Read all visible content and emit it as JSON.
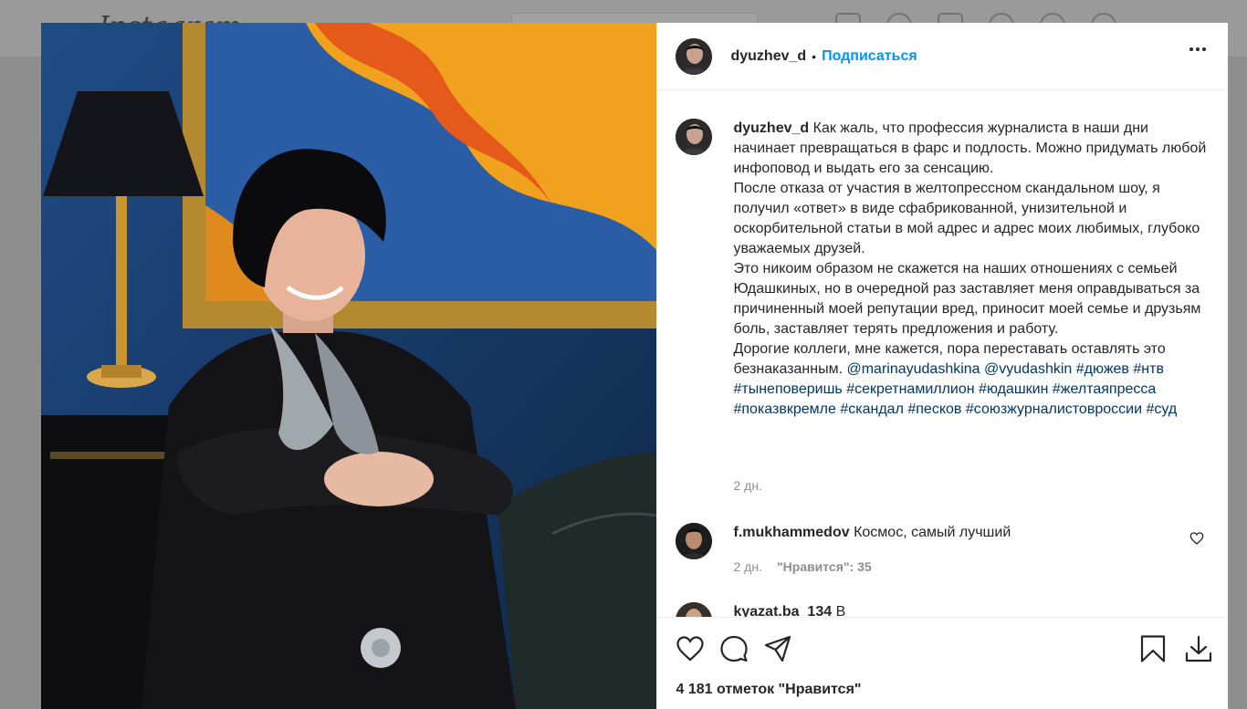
{
  "background": {
    "logo": "Instagram"
  },
  "post": {
    "username": "dyuzhev_d",
    "separator": "•",
    "follow_label": "Подписаться",
    "more_icon": "more-horizontal-icon"
  },
  "caption": {
    "username": "dyuzhev_d",
    "p1": "Как жаль, что профессия журналиста в наши дни начинает превращаться в фарс и подлость. Можно придумать любой инфоповод и выдать его за сенсацию.",
    "p2": "После отказа от участия в желтопрессном скандальном шоу, я получил «ответ» в виде сфабрикованной, унизительной и оскорбительной статьи в мой адрес и адрес моих любимых, глубоко уважаемых друзей.",
    "p3": "Это никоим образом не скажется на наших отношениях с семьей Юдашкиных, но в очередной раз заставляет меня оправдываться за причиненный моей репутации вред, приносит моей семье и друзьям боль, заставляет терять предложения и работу.",
    "p4": "Дорогие коллеги, мне кажется, пора переставать оставлять это безнаказанным.",
    "mentions": [
      "@marinayudashkina",
      "@vyudashkin"
    ],
    "hashtags": [
      "#дюжев",
      "#нтв",
      "#тынеповеришь",
      "#секретнамиллион",
      "#юдашкин",
      "#желтаяпресса",
      "#показвкремле",
      "#скандал",
      "#песков",
      "#союзжурналистовроссии",
      "#суд"
    ],
    "time": "2 дн."
  },
  "comments": [
    {
      "username": "f.mukhammedov",
      "text": "Космос, самый лучший",
      "time": "2 дн.",
      "likes": "\"Нравится\": 35"
    },
    {
      "username": "kyazat.ba_134",
      "text": "В"
    }
  ],
  "actions": {
    "like_icon": "heart-icon",
    "comment_icon": "comment-icon",
    "share_icon": "send-icon",
    "save_icon": "bookmark-icon",
    "download_icon": "download-icon",
    "likes_text": "4 181 отметок \"Нравится\""
  },
  "colors": {
    "accent": "#0095f6",
    "link": "#00376b",
    "muted": "#8e8e8e"
  }
}
